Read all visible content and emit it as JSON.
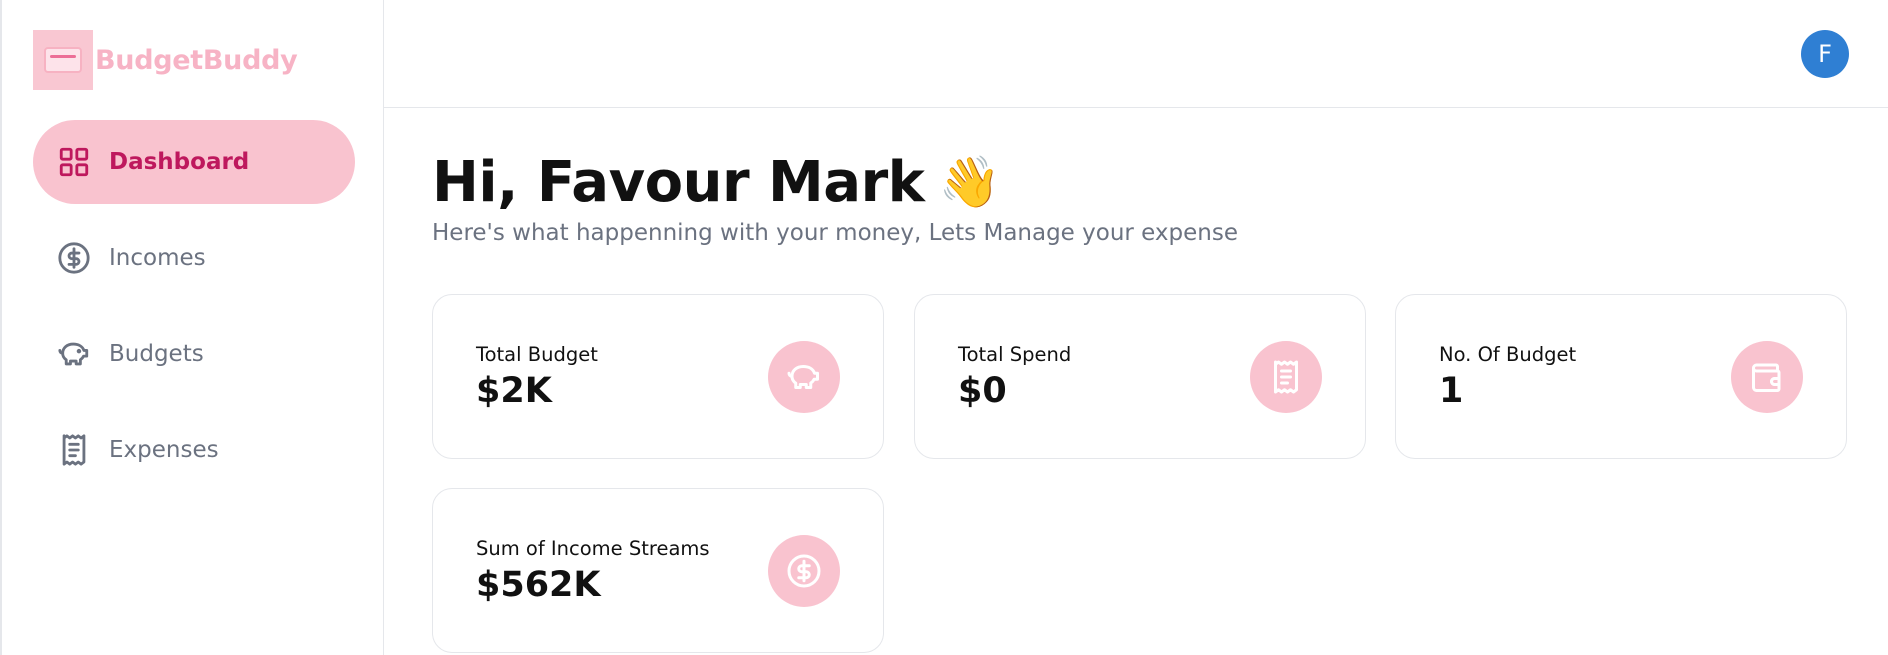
{
  "app": {
    "brand": "BudgetBuddy",
    "colors": {
      "accent": "#f9c3cf",
      "accent_text": "#be185d",
      "avatar": "#2f7fd3",
      "muted": "#6b7280"
    }
  },
  "sidebar": {
    "items": [
      {
        "label": "Dashboard",
        "icon": "grid-icon",
        "active": true
      },
      {
        "label": "Incomes",
        "icon": "dollar-circle-icon",
        "active": false
      },
      {
        "label": "Budgets",
        "icon": "piggy-bank-icon",
        "active": false
      },
      {
        "label": "Expenses",
        "icon": "receipt-icon",
        "active": false
      }
    ]
  },
  "header": {
    "avatar_initial": "F"
  },
  "main": {
    "greeting": "Hi, Favour Mark",
    "greeting_emoji": "👋",
    "subtitle": "Here's what happenning with your money, Lets Manage your expense",
    "cards": [
      {
        "label": "Total Budget",
        "value": "$2K",
        "icon": "piggy-bank-icon"
      },
      {
        "label": "Total Spend",
        "value": "$0",
        "icon": "receipt-icon"
      },
      {
        "label": "No. Of Budget",
        "value": "1",
        "icon": "wallet-icon"
      },
      {
        "label": "Sum of Income Streams",
        "value": "$562K",
        "icon": "dollar-circle-icon"
      }
    ]
  }
}
